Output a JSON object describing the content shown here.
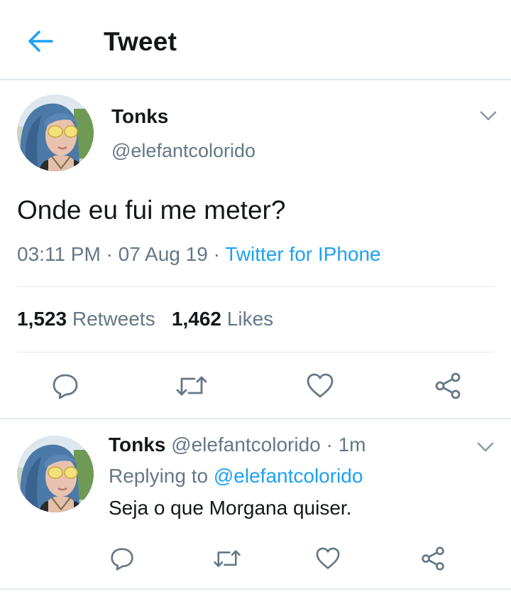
{
  "header": {
    "title": "Tweet",
    "back_icon": "arrow-left-icon",
    "accent": "#1da1f2"
  },
  "tweet": {
    "author_name": "Tonks",
    "author_handle": "@elefantcolorido",
    "text": "Onde eu fui me meter?",
    "time": "03:11 PM",
    "sep1": " · ",
    "date": "07 Aug 19",
    "sep2": " · ",
    "source": "Twitter for IPhone",
    "retweets_count": "1,523",
    "retweets_label": "Retweets",
    "likes_count": "1,462",
    "likes_label": "Likes",
    "actions": [
      "reply-icon",
      "retweet-icon",
      "like-icon",
      "share-icon"
    ]
  },
  "reply": {
    "author_name": "Tonks",
    "author_handle": "@elefantcolorido",
    "sep": " · ",
    "age": "1m",
    "replying_prefix": "Replying to",
    "replying_to": "@elefantcolorido",
    "text": "Seja o que Morgana quiser.",
    "actions": [
      "reply-icon",
      "retweet-icon",
      "like-icon",
      "share-icon"
    ]
  },
  "colors": {
    "text": "#14171a",
    "muted": "#657786",
    "accent": "#1da1f2",
    "divider": "#e1e8ed"
  }
}
